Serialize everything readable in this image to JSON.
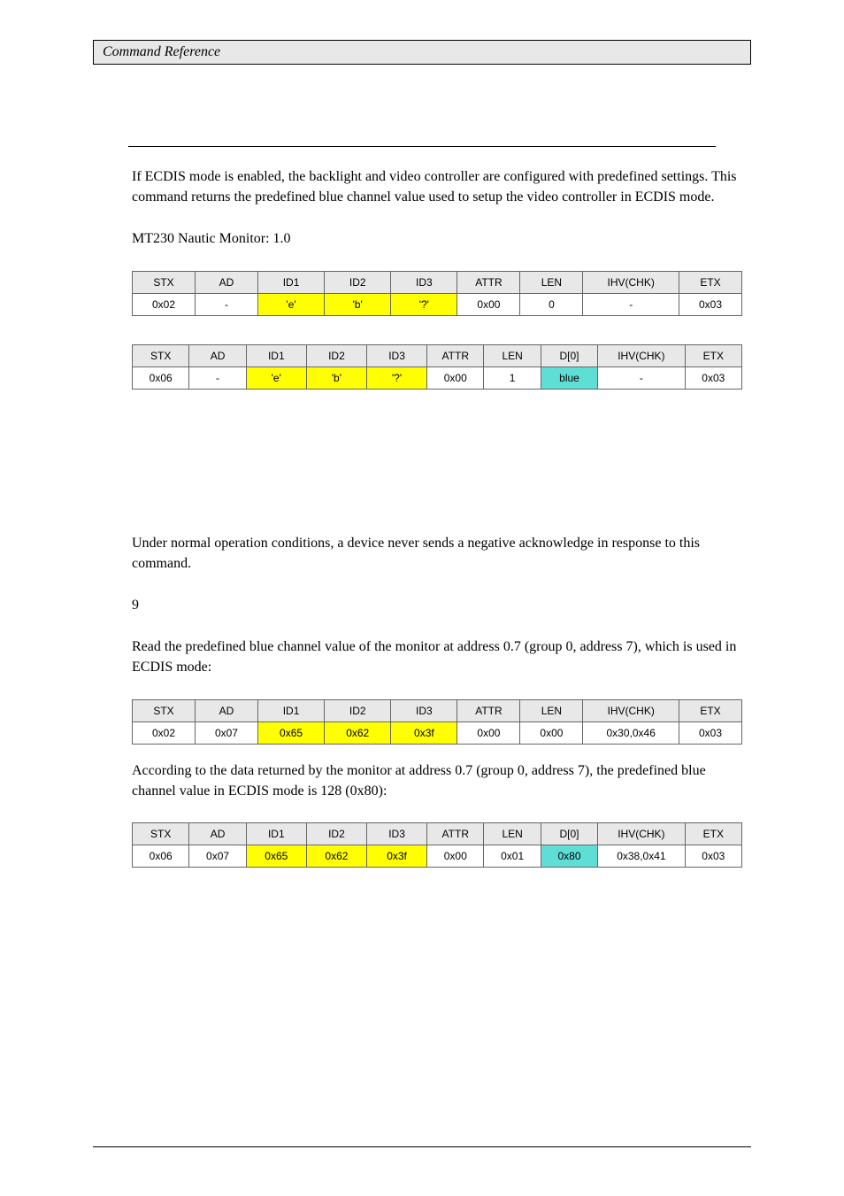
{
  "header": {
    "title": "Command Reference"
  },
  "desc": {
    "text": "If ECDIS mode is enabled, the backlight and video controller are configured with predefined settings. This command returns the predefined blue channel value used to setup the video controller in ECDIS mode."
  },
  "firmware": {
    "text": "MT230 Nautic Monitor: 1.0"
  },
  "req_table": {
    "headers": [
      "STX",
      "AD",
      "ID1",
      "ID2",
      "ID3",
      "ATTR",
      "LEN",
      "IHV(CHK)",
      "ETX"
    ],
    "cells": [
      "0x02",
      "-",
      "'e'",
      "'b'",
      "'?'",
      "0x00",
      "0",
      "-",
      "0x03"
    ],
    "cmd_idx": [
      2,
      3,
      4
    ],
    "data_idx": []
  },
  "ack_table": {
    "headers": [
      "STX",
      "AD",
      "ID1",
      "ID2",
      "ID3",
      "ATTR",
      "LEN",
      "D[0]",
      "IHV(CHK)",
      "ETX"
    ],
    "cells": [
      "0x06",
      "-",
      "'e'",
      "'b'",
      "'?'",
      "0x00",
      "1",
      "blue",
      "-",
      "0x03"
    ],
    "cmd_idx": [
      2,
      3,
      4
    ],
    "data_idx": [
      7
    ]
  },
  "nak": {
    "text": "Under normal operation conditions, a device never sends a negative acknowledge in response to this command."
  },
  "length": {
    "text": "9"
  },
  "example": {
    "p1": "Read the predefined blue channel value of the monitor at address 0.7 (group 0, address 7), which is used in ECDIS mode:",
    "t1": {
      "headers": [
        "STX",
        "AD",
        "ID1",
        "ID2",
        "ID3",
        "ATTR",
        "LEN",
        "IHV(CHK)",
        "ETX"
      ],
      "cells": [
        "0x02",
        "0x07",
        "0x65",
        "0x62",
        "0x3f",
        "0x00",
        "0x00",
        "0x30,0x46",
        "0x03"
      ],
      "cmd_idx": [
        2,
        3,
        4
      ],
      "data_idx": []
    },
    "p2": "According to the data returned by the monitor at address 0.7 (group 0, address 7), the predefined blue channel value in ECDIS mode is 128 (0x80):",
    "t2": {
      "headers": [
        "STX",
        "AD",
        "ID1",
        "ID2",
        "ID3",
        "ATTR",
        "LEN",
        "D[0]",
        "IHV(CHK)",
        "ETX"
      ],
      "cells": [
        "0x06",
        "0x07",
        "0x65",
        "0x62",
        "0x3f",
        "0x00",
        "0x01",
        "0x80",
        "0x38,0x41",
        "0x03"
      ],
      "cmd_idx": [
        2,
        3,
        4
      ],
      "data_idx": [
        7
      ]
    }
  }
}
